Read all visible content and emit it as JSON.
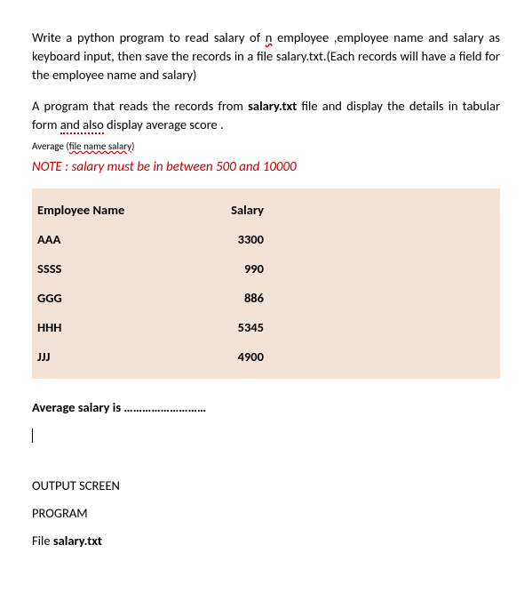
{
  "paragraphs": {
    "p1_before_n": "Write a python program to read salary of ",
    "p1_n": "n",
    "p1_after_n": " employee ,employee name and salary as keyboard input, then save the records in a file salary.txt.(Each records will have a field for the employee name and salary)",
    "p2_before_bold": "A program that reads the records from ",
    "p2_bold": "salary.txt",
    "p2_mid": " file and display the details in tabular form ",
    "p2_dotted": "and also",
    "p2_after": " display average score ."
  },
  "small_line": {
    "before": "Average (",
    "wavy": "file  name  salary",
    "after": ")"
  },
  "note": "NOTE : salary must be in between 500 and 10000",
  "table": {
    "headers": {
      "col1": "Employee Name",
      "col2": "Salary"
    },
    "rows": [
      {
        "name": "AAA",
        "salary": "3300"
      },
      {
        "name": "SSSS",
        "salary": "990"
      },
      {
        "name": "GGG",
        "salary": "886"
      },
      {
        "name": "HHH",
        "salary": "5345"
      },
      {
        "name": "JJJ",
        "salary": "4900"
      }
    ]
  },
  "avg_line": "Average salary is ………………………",
  "output": {
    "line1": "OUTPUT SCREEN",
    "line2": "PROGRAM",
    "line3_before": "File ",
    "line3_bold": "salary.txt"
  }
}
